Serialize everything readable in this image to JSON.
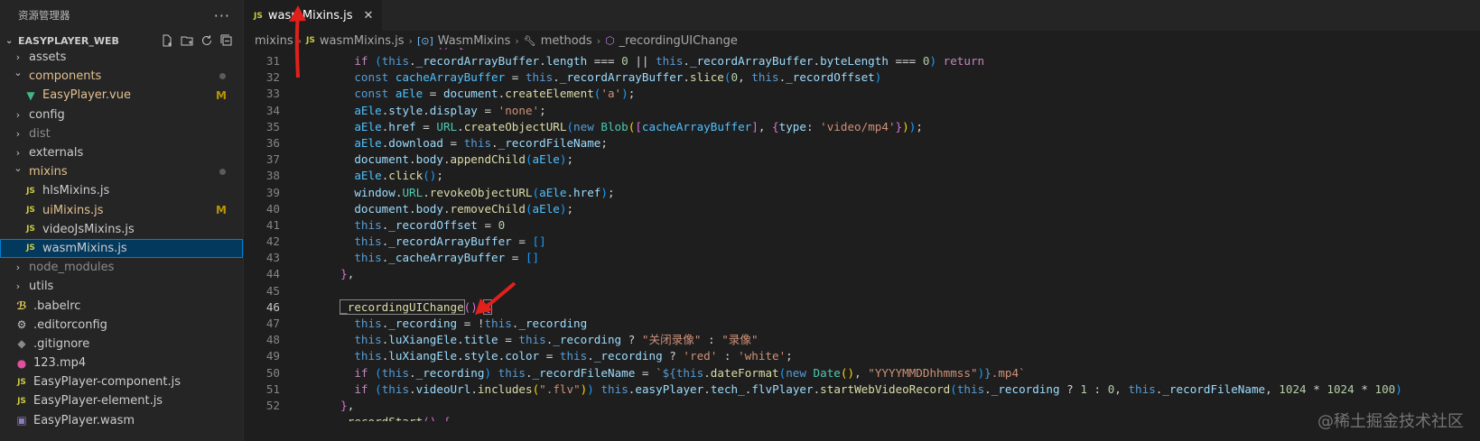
{
  "sidebar": {
    "title": "资源管理器",
    "more_icon": "ellipsis-icon",
    "project": "EASYPLAYER_WEB",
    "items": [
      {
        "label": "assets",
        "kind": "folder",
        "expanded": false,
        "indent": 0
      },
      {
        "label": "components",
        "kind": "folder",
        "expanded": true,
        "indent": 0,
        "color": "#e2c08d",
        "dot": true
      },
      {
        "label": "EasyPlayer.vue",
        "kind": "vue",
        "indent": 1,
        "color": "#e2c08d",
        "badge": "M"
      },
      {
        "label": "config",
        "kind": "folder",
        "expanded": false,
        "indent": 0
      },
      {
        "label": "dist",
        "kind": "folder",
        "expanded": false,
        "indent": 0,
        "color": "#8c8c8c"
      },
      {
        "label": "externals",
        "kind": "folder",
        "expanded": false,
        "indent": 0
      },
      {
        "label": "mixins",
        "kind": "folder",
        "expanded": true,
        "indent": 0,
        "color": "#e2c08d",
        "dot": true
      },
      {
        "label": "hlsMixins.js",
        "kind": "js",
        "indent": 1
      },
      {
        "label": "uiMixins.js",
        "kind": "js",
        "indent": 1,
        "color": "#e2c08d",
        "badge": "M"
      },
      {
        "label": "videoJsMixins.js",
        "kind": "js",
        "indent": 1
      },
      {
        "label": "wasmMixins.js",
        "kind": "js",
        "indent": 1,
        "selected": true
      },
      {
        "label": "node_modules",
        "kind": "folder",
        "expanded": false,
        "indent": 0,
        "color": "#8c8c8c"
      },
      {
        "label": "utils",
        "kind": "folder",
        "expanded": false,
        "indent": 0
      },
      {
        "label": ".babelrc",
        "kind": "babel",
        "indent": 0
      },
      {
        "label": ".editorconfig",
        "kind": "gear",
        "indent": 0
      },
      {
        "label": ".gitignore",
        "kind": "git",
        "indent": 0
      },
      {
        "label": "123.mp4",
        "kind": "media",
        "indent": 0
      },
      {
        "label": "EasyPlayer-component.js",
        "kind": "js",
        "indent": 0
      },
      {
        "label": "EasyPlayer-element.js",
        "kind": "js",
        "indent": 0
      },
      {
        "label": "EasyPlayer.wasm",
        "kind": "wasm",
        "indent": 0
      }
    ]
  },
  "tab": {
    "label": "wasmMixins.js",
    "icon_text": "JS"
  },
  "breadcrumb": {
    "folder": "mixins",
    "file": "wasmMixins.js",
    "object": "WasmMixins",
    "methods": "methods",
    "method": "_recordingUIChange"
  },
  "code": {
    "line_numbers": [
      "31",
      "32",
      "33",
      "34",
      "35",
      "36",
      "37",
      "38",
      "39",
      "40",
      "41",
      "42",
      "43",
      "44",
      "45",
      "46",
      "47",
      "48",
      "49",
      "50",
      "51",
      "52"
    ],
    "active_line": "46"
  },
  "watermark": "@稀土掘金技术社区"
}
